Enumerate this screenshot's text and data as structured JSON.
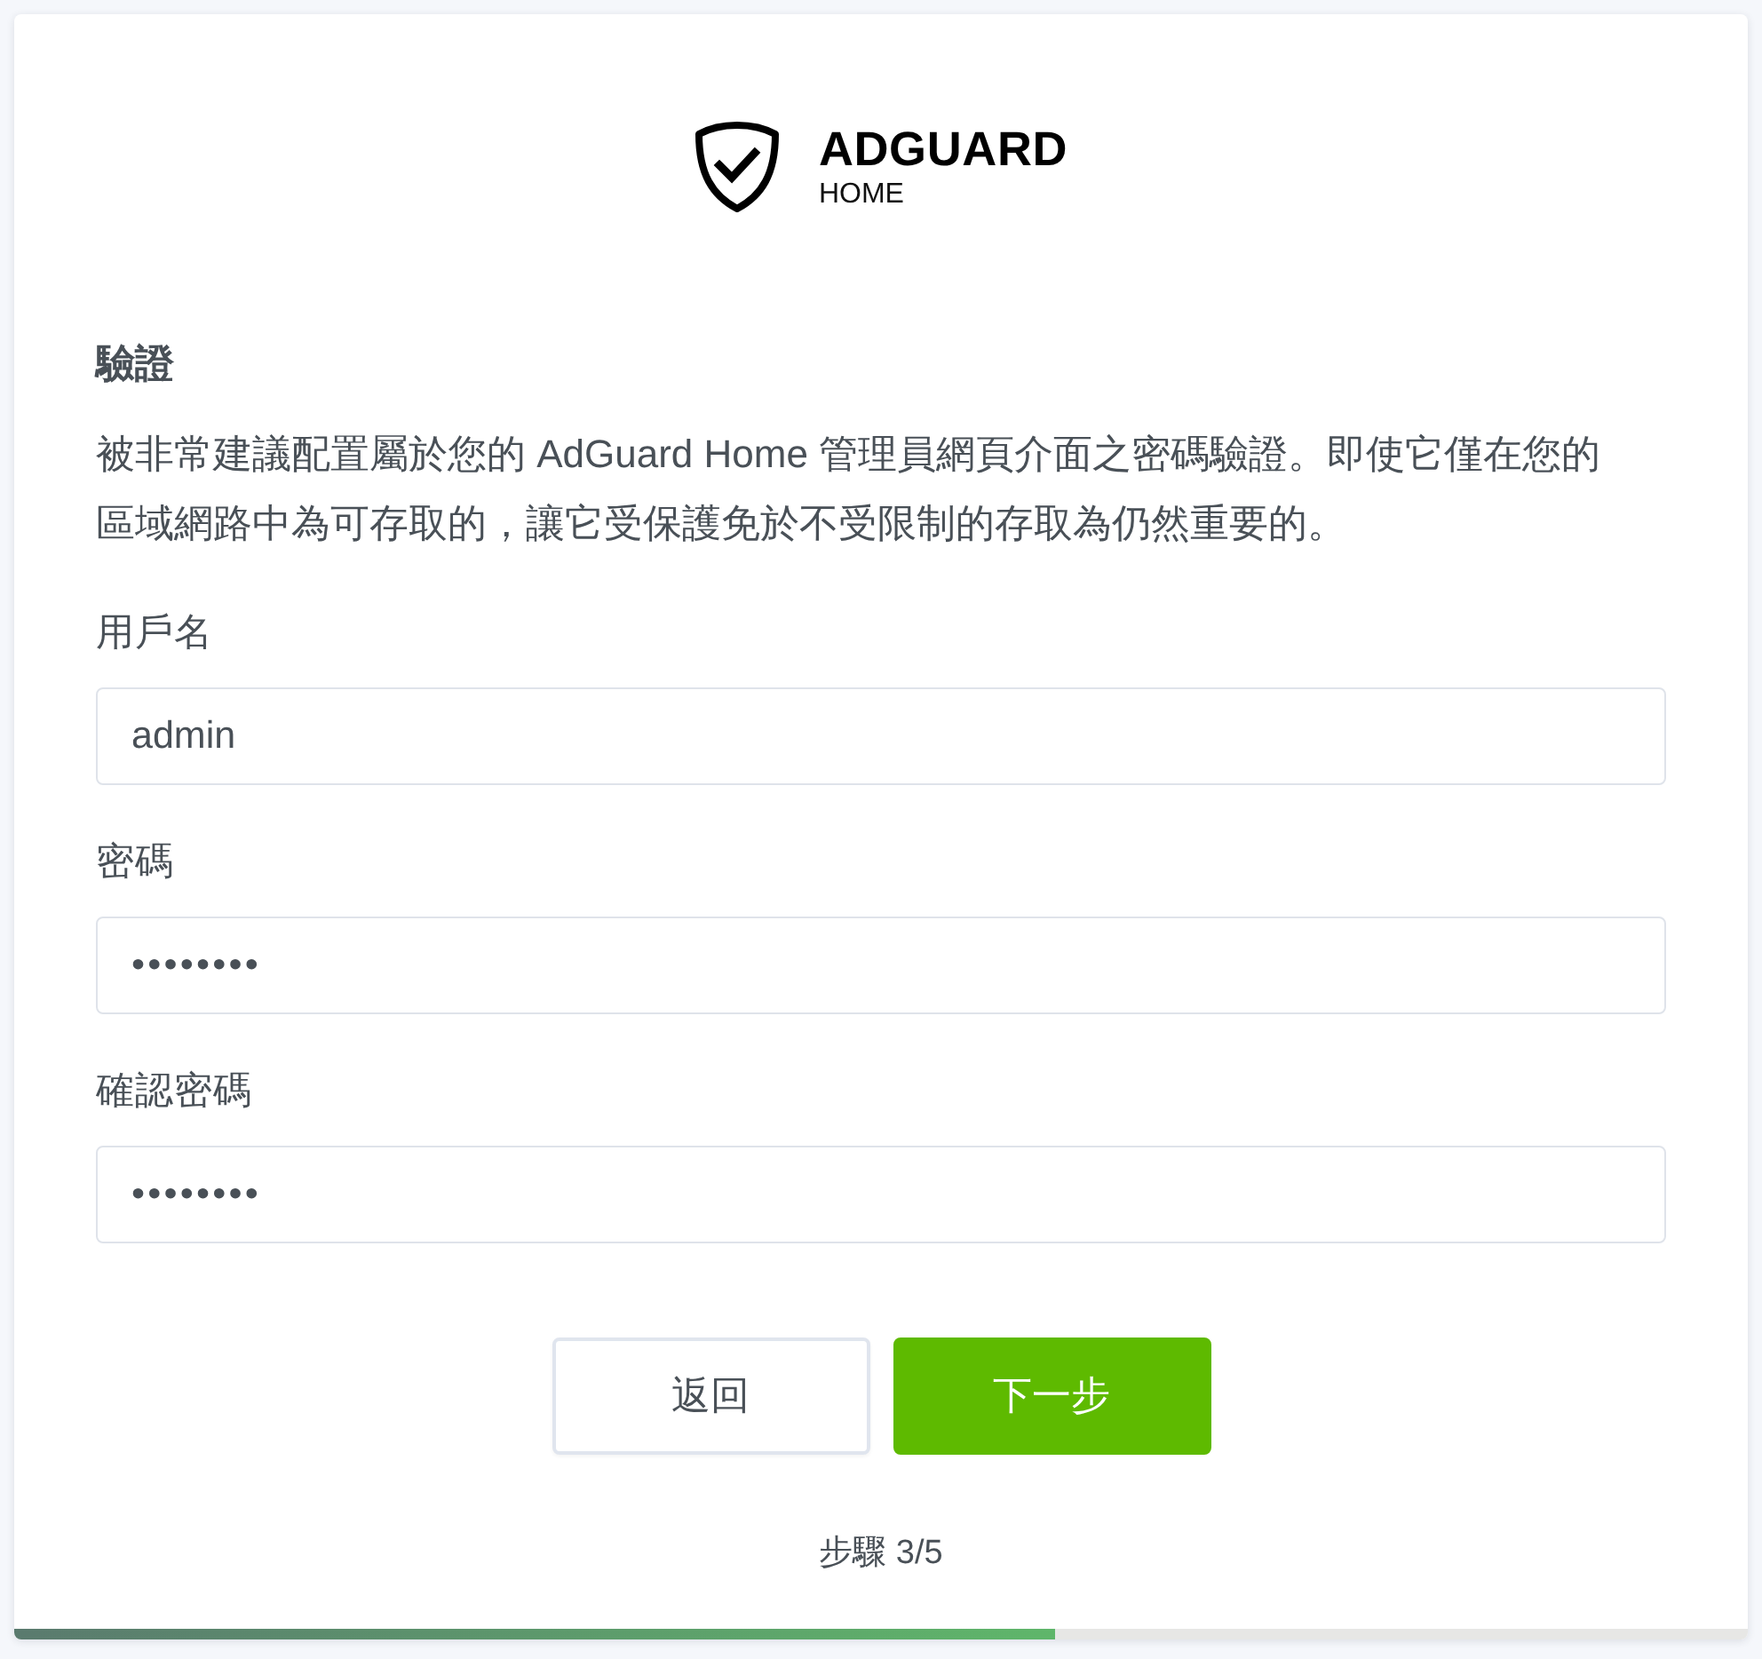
{
  "logo": {
    "title": "ADGUARD",
    "subtitle": "HOME"
  },
  "section": {
    "title": "驗證",
    "description": "被非常建議配置屬於您的 AdGuard Home 管理員網頁介面之密碼驗證。即使它僅在您的區域網路中為可存取的，讓它受保護免於不受限制的存取為仍然重要的。"
  },
  "fields": [
    {
      "label": "用戶名",
      "value": "admin",
      "kind": "text"
    },
    {
      "label": "密碼",
      "value": "••••••••",
      "kind": "password"
    },
    {
      "label": "確認密碼",
      "value": "••••••••",
      "kind": "password"
    }
  ],
  "buttons": [
    {
      "label": "返回",
      "kind": "secondary"
    },
    {
      "label": "下一步",
      "kind": "primary"
    }
  ],
  "step": {
    "text": "步驟 3/5"
  },
  "progress": {
    "level": 0.6
  }
}
